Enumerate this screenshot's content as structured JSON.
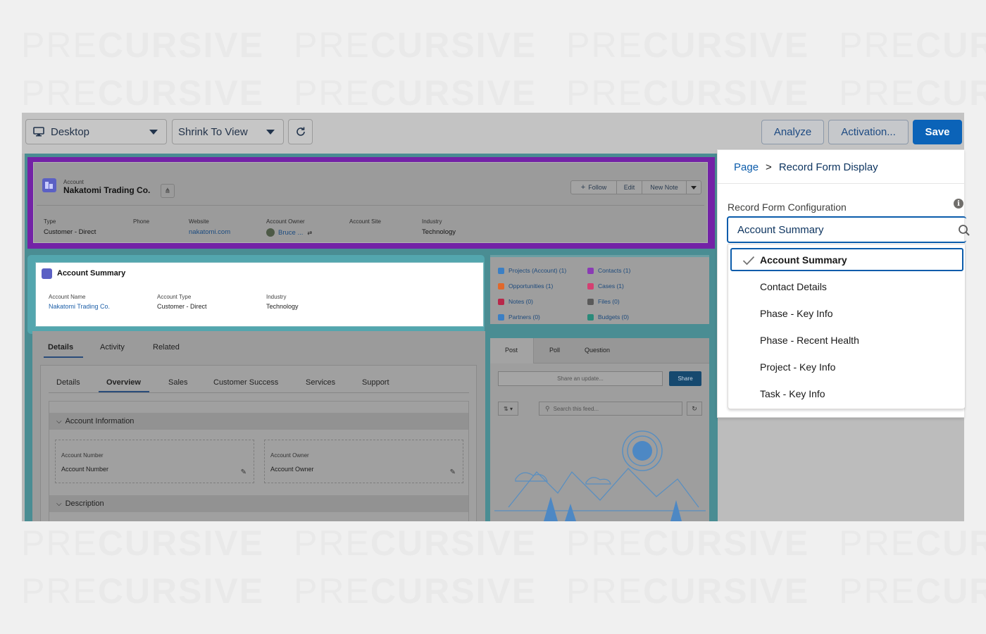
{
  "watermark": {
    "part1": "PRE",
    "part2": "CURSIVE"
  },
  "toolbar": {
    "device_select": "Desktop",
    "view_select": "Shrink To View",
    "analyze_label": "Analyze",
    "activation_label": "Activation...",
    "save_label": "Save"
  },
  "record_header": {
    "object_label": "Account",
    "name": "Nakatomi Trading Co.",
    "actions": {
      "follow": "Follow",
      "edit": "Edit",
      "new_note": "New Note"
    },
    "fields": [
      {
        "label": "Type",
        "value": "Customer - Direct"
      },
      {
        "label": "Phone",
        "value": ""
      },
      {
        "label": "Website",
        "value": "nakatomi.com"
      },
      {
        "label": "Account Owner",
        "value": "Bruce ..."
      },
      {
        "label": "Account Site",
        "value": ""
      },
      {
        "label": "Industry",
        "value": "Technology"
      }
    ]
  },
  "account_summary": {
    "title": "Account Summary",
    "fields": [
      {
        "label": "Account Name",
        "value": "Nakatomi Trading Co."
      },
      {
        "label": "Account Type",
        "value": "Customer - Direct"
      },
      {
        "label": "Industry",
        "value": "Technology"
      }
    ]
  },
  "related_list": {
    "items": [
      {
        "label": "Projects (Account) (1)",
        "color": "#3b7fc4"
      },
      {
        "label": "Contacts (1)",
        "color": "#8a3bb5"
      },
      {
        "label": "Opportunities (1)",
        "color": "#e0682c"
      },
      {
        "label": "Cases (1)",
        "color": "#d43f72"
      },
      {
        "label": "Notes (0)",
        "color": "#b8284a"
      },
      {
        "label": "Files (0)",
        "color": "#5a5a5a"
      },
      {
        "label": "Partners (0)",
        "color": "#3b7fc4"
      },
      {
        "label": "Budgets (0)",
        "color": "#2a8a7a"
      }
    ]
  },
  "record_tabs": {
    "main": [
      "Details",
      "Activity",
      "Related"
    ],
    "sub": [
      "Details",
      "Overview",
      "Sales",
      "Customer Success",
      "Services",
      "Support"
    ],
    "section_account_info": "Account Information",
    "section_description": "Description",
    "field1": {
      "label": "Account Number",
      "value": "Account Number"
    },
    "field2": {
      "label": "Account Owner",
      "value": "Account Owner"
    }
  },
  "feed": {
    "tabs": [
      "Post",
      "Poll",
      "Question"
    ],
    "share_placeholder": "Share an update...",
    "share_button": "Share",
    "search_placeholder": "Search this feed..."
  },
  "property_panel": {
    "breadcrumb_root": "Page",
    "breadcrumb_sep": ">",
    "breadcrumb_current": "Record Form Display",
    "config_label": "Record Form Configuration",
    "combo_value": "Account Summary",
    "options": [
      {
        "label": "Account Summary",
        "selected": true
      },
      {
        "label": "Contact Details",
        "selected": false
      },
      {
        "label": "Phase - Key Info",
        "selected": false
      },
      {
        "label": "Phase - Recent Health",
        "selected": false
      },
      {
        "label": "Project - Key Info",
        "selected": false
      },
      {
        "label": "Task - Key Info",
        "selected": false
      }
    ]
  }
}
